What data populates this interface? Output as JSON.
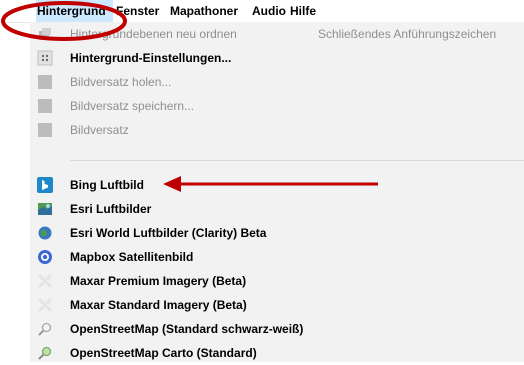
{
  "menubar": {
    "items": [
      {
        "label": "Hintergrund"
      },
      {
        "label": "Fenster"
      },
      {
        "label": "Mapathoner"
      },
      {
        "label": "Audio"
      },
      {
        "label": "Hilfe"
      }
    ]
  },
  "dropdown": {
    "items": [
      {
        "label": "Hintergrundebenen neu ordnen",
        "shortcut": "Schließendes Anführungszeichen",
        "enabled": false,
        "icon": "layers-reorder-icon"
      },
      {
        "label": "Hintergrund-Einstellungen...",
        "enabled": true,
        "icon": "settings-dots-icon"
      },
      {
        "label": "Bildversatz holen...",
        "enabled": false,
        "icon": "offset-download-icon"
      },
      {
        "label": "Bildversatz speichern...",
        "enabled": false,
        "icon": "offset-save-icon"
      },
      {
        "label": "Bildversatz",
        "enabled": false,
        "icon": "offset-icon"
      },
      {
        "label": "Bing Luftbild",
        "enabled": true,
        "icon": "bing-icon"
      },
      {
        "label": "Esri Luftbilder",
        "enabled": true,
        "icon": "esri-map-icon"
      },
      {
        "label": "Esri World Luftbilder (Clarity) Beta",
        "enabled": true,
        "icon": "globe-icon"
      },
      {
        "label": "Mapbox Satellitenbild",
        "enabled": true,
        "icon": "mapbox-icon"
      },
      {
        "label": "Maxar Premium Imagery (Beta)",
        "enabled": true,
        "icon": "maxar-icon"
      },
      {
        "label": "Maxar Standard Imagery (Beta)",
        "enabled": true,
        "icon": "maxar-icon"
      },
      {
        "label": "OpenStreetMap (Standard schwarz-weiß)",
        "enabled": true,
        "icon": "osm-magnifier-icon"
      },
      {
        "label": "OpenStreetMap Carto (Standard)",
        "enabled": true,
        "icon": "osm-carto-icon"
      }
    ]
  },
  "colors": {
    "menu_highlight": "#cce8ff",
    "annotation_red": "#c00000",
    "menu_background": "#f2f2f2"
  }
}
